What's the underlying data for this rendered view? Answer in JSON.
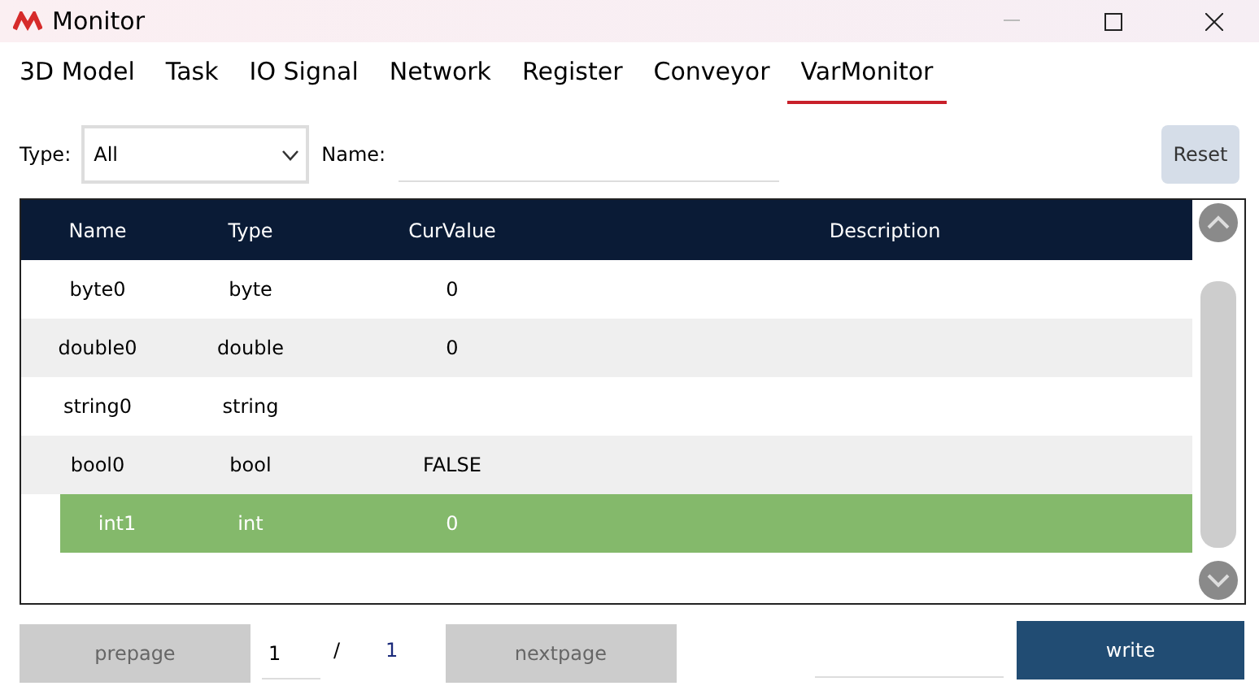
{
  "window": {
    "title": "Monitor"
  },
  "tabs": [
    {
      "label": "3D Model",
      "selected": false
    },
    {
      "label": "Task",
      "selected": false
    },
    {
      "label": "IO Signal",
      "selected": false
    },
    {
      "label": "Network",
      "selected": false
    },
    {
      "label": "Register",
      "selected": false
    },
    {
      "label": "Conveyor",
      "selected": false
    },
    {
      "label": "VarMonitor",
      "selected": true
    }
  ],
  "filter": {
    "type_label": "Type:",
    "type_value": "All",
    "name_label": "Name:",
    "reset": "Reset"
  },
  "table": {
    "columns": [
      "Name",
      "Type",
      "CurValue",
      "Description"
    ],
    "rows": [
      {
        "name": "byte0",
        "type": "byte",
        "value": "0",
        "selected": false
      },
      {
        "name": "double0",
        "type": "double",
        "value": "0",
        "selected": false
      },
      {
        "name": "string0",
        "type": "string",
        "selected": false
      },
      {
        "name": "bool0",
        "type": "bool",
        "value": "FALSE",
        "selected": false
      },
      {
        "name": "int1",
        "type": "int",
        "value": "0",
        "selected": true
      }
    ]
  },
  "pager": {
    "prev": "prepage",
    "page": "1",
    "sep": "/",
    "total": "1",
    "next": "nextpage",
    "write": "write"
  }
}
